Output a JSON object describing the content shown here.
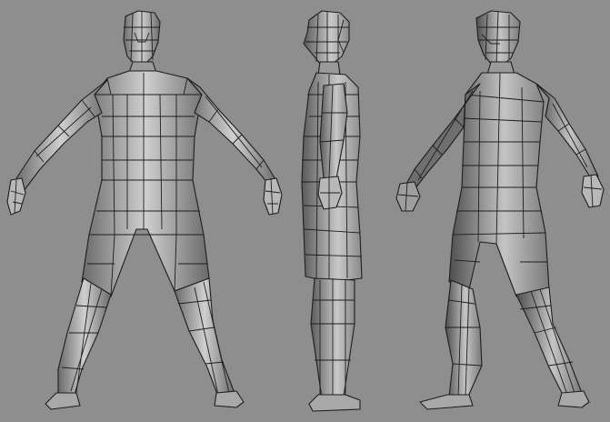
{
  "viewport": {
    "background": "#8e8e8e",
    "views": [
      {
        "name": "front"
      },
      {
        "name": "side"
      },
      {
        "name": "three-quarter"
      }
    ]
  },
  "colors": {
    "mesh_light": "#d2d2d2",
    "mesh_mid": "#a9a9a9",
    "mesh_dark": "#5c5c5c",
    "wire": "#1e1e1e"
  }
}
